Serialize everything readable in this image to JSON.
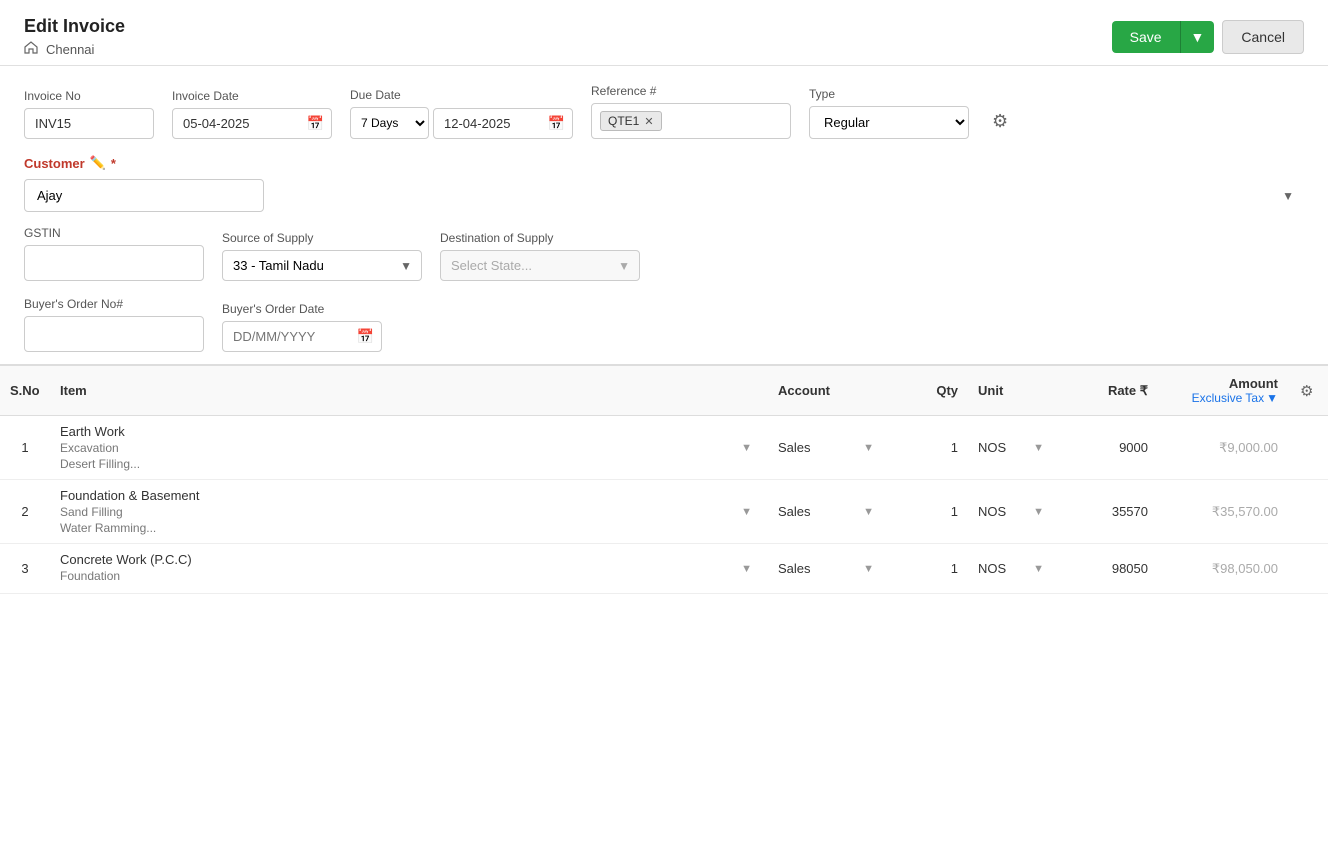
{
  "header": {
    "title": "Edit Invoice",
    "location": "Chennai",
    "save_label": "Save",
    "cancel_label": "Cancel"
  },
  "form": {
    "invoice_no_label": "Invoice No",
    "invoice_no_value": "INV15",
    "invoice_date_label": "Invoice Date",
    "invoice_date_value": "05-04-2025",
    "due_date_label": "Due Date",
    "due_days_value": "7 Days",
    "due_date_value": "12-04-2025",
    "reference_label": "Reference #",
    "reference_tag": "QTE1",
    "type_label": "Type",
    "type_value": "Regular",
    "customer_label": "Customer",
    "customer_value": "Ajay",
    "gstin_label": "GSTIN",
    "gstin_value": "",
    "source_supply_label": "Source of Supply",
    "source_supply_value": "33 - Tamil Nadu",
    "dest_supply_label": "Destination of Supply",
    "dest_supply_placeholder": "Select State...",
    "buyer_order_label": "Buyer's Order No#",
    "buyer_order_value": "",
    "buyer_order_date_label": "Buyer's Order Date",
    "buyer_order_date_placeholder": "DD/MM/YYYY"
  },
  "table": {
    "col_sno": "S.No",
    "col_item": "Item",
    "col_account": "Account",
    "col_qty": "Qty",
    "col_unit": "Unit",
    "col_rate": "Rate ₹",
    "col_amount": "Amount",
    "col_tax": "Exclusive Tax",
    "rows": [
      {
        "sno": "1",
        "item_name": "Earth Work",
        "item_desc1": "Excavation",
        "item_desc2": "Desert Filling...",
        "account": "Sales",
        "qty": "1",
        "unit": "NOS",
        "rate": "9000",
        "amount": "₹9,000.00"
      },
      {
        "sno": "2",
        "item_name": "Foundation & Basement",
        "item_desc1": "Sand Filling",
        "item_desc2": "Water Ramming...",
        "account": "Sales",
        "qty": "1",
        "unit": "NOS",
        "rate": "35570",
        "amount": "₹35,570.00"
      },
      {
        "sno": "3",
        "item_name": "Concrete Work (P.C.C)",
        "item_desc1": "Foundation",
        "item_desc2": "",
        "account": "Sales",
        "qty": "1",
        "unit": "NOS",
        "rate": "98050",
        "amount": "₹98,050.00"
      }
    ]
  }
}
